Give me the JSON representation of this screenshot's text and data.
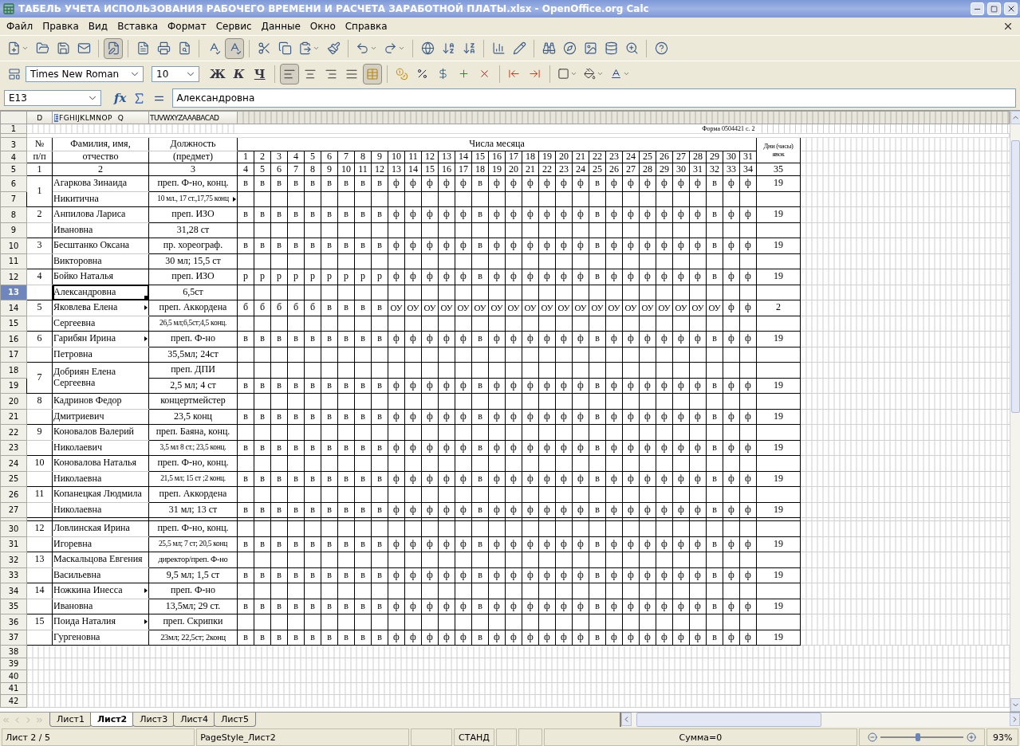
{
  "window": {
    "title": "ТАБЕЛЬ УЧЕТА ИСПОЛЬЗОВАНИЯ РАБОЧЕГО ВРЕМЕНИ И РАСЧЕТА ЗАРАБОТНОЙ ПЛАТЫ.xlsx - OpenOffice.org Calc"
  },
  "menu": [
    "Файл",
    "Правка",
    "Вид",
    "Вставка",
    "Формат",
    "Сервис",
    "Данные",
    "Окно",
    "Справка"
  ],
  "standard_toolbar": {
    "edit_mode": true,
    "auto_spellcheck": true
  },
  "formatting_toolbar": {
    "font_name": "Times New Roman",
    "font_size": "10",
    "style_buttons": [
      "Ж",
      "К",
      "Ч"
    ],
    "alignment": [
      {
        "selected": true
      },
      {
        "selected": false
      },
      {
        "selected": false
      },
      {
        "selected": false
      }
    ],
    "merge_on": true
  },
  "formula_bar": {
    "cell": "E13",
    "function_wizard": "fx",
    "content": "Александровна"
  },
  "column_headers": {
    "number": [
      {
        "label": "D",
        "selected": false
      }
    ],
    "name": [
      {
        "label": "E",
        "selected": true
      },
      {
        "label": "F",
        "selected": false
      },
      {
        "label": "G",
        "selected": false
      },
      {
        "label": "H",
        "selected": false
      },
      {
        "label": "I",
        "selected": false
      },
      {
        "label": "J",
        "selected": false
      },
      {
        "label": "K",
        "selected": false
      },
      {
        "label": "L",
        "selected": false
      },
      {
        "label": "M",
        "selected": false
      },
      {
        "label": "N",
        "selected": false
      },
      {
        "label": "O",
        "selected": false
      },
      {
        "label": "P",
        "selected": false
      },
      {
        "label": "Q",
        "selected": false
      }
    ],
    "position": [
      {
        "label": "T",
        "selected": false
      },
      {
        "label": "U",
        "selected": false
      },
      {
        "label": "V",
        "selected": false
      },
      {
        "label": "W",
        "selected": false
      },
      {
        "label": "X",
        "selected": false
      },
      {
        "label": "Y",
        "selected": false
      },
      {
        "label": "Z",
        "selected": false
      },
      {
        "label": "AA",
        "selected": false
      },
      {
        "label": "AB",
        "selected": false
      },
      {
        "label": "AC",
        "selected": false
      },
      {
        "label": "AD",
        "selected": false
      }
    ]
  },
  "form_header": {
    "row_numbers": [
      "1",
      "3",
      "4",
      "5"
    ],
    "form_code": "Форма 0504421 с. 2",
    "number_heading": [
      "№",
      "п/п"
    ],
    "name_heading": [
      "Фамилия, имя,",
      "отчество"
    ],
    "position_heading": [
      "Должность",
      "(предмет)"
    ],
    "days_heading": "Числа месяца",
    "total_heading": "Дни (часы) явок",
    "days": [
      "1",
      "2",
      "3",
      "4",
      "5",
      "6",
      "7",
      "8",
      "9",
      "10",
      "11",
      "12",
      "13",
      "14",
      "15",
      "16",
      "17",
      "18",
      "19",
      "20",
      "21",
      "22",
      "23",
      "24",
      "25",
      "26",
      "27",
      "28",
      "29",
      "30",
      "31"
    ],
    "column_numbers": [
      "1",
      "2",
      "3",
      "4",
      "5",
      "6",
      "7",
      "8",
      "9",
      "10",
      "11",
      "12",
      "13",
      "14",
      "15",
      "16",
      "17",
      "18",
      "19",
      "20",
      "21",
      "22",
      "23",
      "24",
      "25",
      "26",
      "27",
      "28",
      "29",
      "30",
      "31",
      "32",
      "33",
      "34",
      "35"
    ]
  },
  "people": [
    {
      "kind": "person",
      "number": "1",
      "merged": true,
      "rows": [
        {
          "row": "6",
          "selected": false,
          "name": "Агаркова Зинаида",
          "position": "преп. Ф-но, конц.",
          "marks": [
            "в",
            "в",
            "в",
            "в",
            "в",
            "в",
            "в",
            "в",
            "в",
            "ф",
            "ф",
            "ф",
            "ф",
            "ф",
            "в",
            "ф",
            "ф",
            "ф",
            "ф",
            "ф",
            "ф",
            "в",
            "ф",
            "ф",
            "ф",
            "ф",
            "ф",
            "ф",
            "в",
            "ф",
            "ф"
          ],
          "total": "19"
        },
        {
          "row": "7",
          "selected": false,
          "name": "Никитична",
          "position": "10 мл., 17 ст.,17,75 конц",
          "position_overflow": true
        }
      ]
    },
    {
      "kind": "person",
      "number": "2",
      "merged": false,
      "rows": [
        {
          "row": "8",
          "selected": false,
          "name": "Анпилова Лариса",
          "position": "преп. ИЗО",
          "marks": [
            "в",
            "в",
            "в",
            "в",
            "в",
            "в",
            "в",
            "в",
            "в",
            "ф",
            "ф",
            "ф",
            "ф",
            "ф",
            "в",
            "ф",
            "ф",
            "ф",
            "ф",
            "ф",
            "ф",
            "в",
            "ф",
            "ф",
            "ф",
            "ф",
            "ф",
            "ф",
            "в",
            "ф",
            "ф"
          ],
          "total": "19"
        },
        {
          "row": "9",
          "selected": false,
          "name": "Ивановна",
          "position": "31,28 ст"
        }
      ]
    },
    {
      "kind": "person",
      "number": "3",
      "merged": false,
      "rows": [
        {
          "row": "10",
          "selected": false,
          "name": "Бесштанко Оксана",
          "position": "пр. хореограф.",
          "marks": [
            "в",
            "в",
            "в",
            "в",
            "в",
            "в",
            "в",
            "в",
            "в",
            "ф",
            "ф",
            "ф",
            "ф",
            "ф",
            "в",
            "ф",
            "ф",
            "ф",
            "ф",
            "ф",
            "ф",
            "в",
            "ф",
            "ф",
            "ф",
            "ф",
            "ф",
            "ф",
            "в",
            "ф",
            "ф"
          ],
          "total": "19"
        },
        {
          "row": "11",
          "selected": false,
          "name": "Викторовна",
          "position": "30 мл; 15,5 ст"
        }
      ]
    },
    {
      "kind": "person",
      "number": "4",
      "merged": false,
      "rows": [
        {
          "row": "12",
          "selected": false,
          "name": "Бойко Наталья",
          "position": "преп. ИЗО",
          "marks": [
            "р",
            "р",
            "р",
            "р",
            "р",
            "р",
            "р",
            "р",
            "р",
            "ф",
            "ф",
            "ф",
            "ф",
            "ф",
            "в",
            "ф",
            "ф",
            "ф",
            "ф",
            "ф",
            "ф",
            "в",
            "ф",
            "ф",
            "ф",
            "ф",
            "ф",
            "ф",
            "в",
            "ф",
            "ф"
          ],
          "total": "19"
        },
        {
          "row": "13",
          "selected": true,
          "name": "Александровна",
          "position": "6,5ст"
        }
      ]
    },
    {
      "kind": "person",
      "number": "5",
      "merged": false,
      "rows": [
        {
          "row": "14",
          "selected": false,
          "name": "Яковлева  Елена",
          "name_overflow": true,
          "position": "преп. Аккордена",
          "marks": [
            "б",
            "б",
            "б",
            "б",
            "б",
            "в",
            "в",
            "в",
            "в",
            "ОУ",
            "ОУ",
            "ОУ",
            "ОУ",
            "ОУ",
            "ОУ",
            "ОУ",
            "ОУ",
            "ОУ",
            "ОУ",
            "ОУ",
            "ОУ",
            "ОУ",
            "ОУ",
            "ОУ",
            "ОУ",
            "ОУ",
            "ОУ",
            "ОУ",
            "ОУ",
            "ф",
            "ф"
          ],
          "total": "2"
        },
        {
          "row": "15",
          "selected": false,
          "name": "Сергеевна",
          "position": "26,5 мл;6,5ст;4,5 конц."
        }
      ]
    },
    {
      "kind": "person",
      "number": "6",
      "merged": false,
      "rows": [
        {
          "row": "16",
          "selected": false,
          "name": "Гарибян Ирина",
          "name_overflow": true,
          "position": "преп. Ф-но",
          "marks": [
            "в",
            "в",
            "в",
            "в",
            "в",
            "в",
            "в",
            "в",
            "в",
            "ф",
            "ф",
            "ф",
            "ф",
            "ф",
            "в",
            "ф",
            "ф",
            "ф",
            "ф",
            "ф",
            "ф",
            "в",
            "ф",
            "ф",
            "ф",
            "ф",
            "ф",
            "ф",
            "в",
            "ф",
            "ф"
          ],
          "total": "19"
        },
        {
          "row": "17",
          "selected": false,
          "name": "Петровна",
          "position": "35,5мл;  24ст"
        }
      ]
    },
    {
      "kind": "person",
      "number": "7",
      "merged": true,
      "name": "Добриян Елена Сергеевна",
      "rows": [
        {
          "row": "18",
          "selected": false,
          "position": "преп. ДПИ"
        },
        {
          "row": "19",
          "selected": false,
          "position": "2,5 мл; 4 ст",
          "marks": [
            "в",
            "в",
            "в",
            "в",
            "в",
            "в",
            "в",
            "в",
            "в",
            "ф",
            "ф",
            "ф",
            "ф",
            "ф",
            "в",
            "ф",
            "ф",
            "ф",
            "ф",
            "ф",
            "ф",
            "в",
            "ф",
            "ф",
            "ф",
            "ф",
            "ф",
            "ф",
            "в",
            "ф",
            "ф"
          ],
          "total": "19"
        }
      ]
    },
    {
      "kind": "person",
      "number": "8",
      "merged": false,
      "rows": [
        {
          "row": "20",
          "selected": false,
          "name": "Кадринов Федор",
          "position": "концертмейстер"
        },
        {
          "row": "21",
          "selected": false,
          "name": "Дмитриевич",
          "position": "23,5 конц",
          "marks": [
            "в",
            "в",
            "в",
            "в",
            "в",
            "в",
            "в",
            "в",
            "в",
            "ф",
            "ф",
            "ф",
            "ф",
            "ф",
            "в",
            "ф",
            "ф",
            "ф",
            "ф",
            "ф",
            "ф",
            "в",
            "ф",
            "ф",
            "ф",
            "ф",
            "ф",
            "ф",
            "в",
            "ф",
            "ф"
          ],
          "total": "19"
        }
      ]
    },
    {
      "kind": "person",
      "number": "9",
      "merged": false,
      "rows": [
        {
          "row": "22",
          "selected": false,
          "name": "Коновалов Валерий",
          "position": "преп. Баяна, конц."
        },
        {
          "row": "23",
          "selected": false,
          "name": "Николаевич",
          "position": "3,5 мл 8 ст.; 23,5 конц.",
          "marks": [
            "в",
            "в",
            "в",
            "в",
            "в",
            "в",
            "в",
            "в",
            "в",
            "ф",
            "ф",
            "ф",
            "ф",
            "ф",
            "в",
            "ф",
            "ф",
            "ф",
            "ф",
            "ф",
            "ф",
            "в",
            "ф",
            "ф",
            "ф",
            "ф",
            "ф",
            "ф",
            "в",
            "ф",
            "ф"
          ],
          "total": "19"
        }
      ]
    },
    {
      "kind": "person",
      "number": "10",
      "merged": false,
      "rows": [
        {
          "row": "24",
          "selected": false,
          "name": "Коновалова Наталья",
          "position": "преп. Ф-но, конц."
        },
        {
          "row": "25",
          "selected": false,
          "name": "Николаевна",
          "position": "21,5 мл; 15 ст ;2 конц.",
          "marks": [
            "в",
            "в",
            "в",
            "в",
            "в",
            "в",
            "в",
            "в",
            "в",
            "ф",
            "ф",
            "ф",
            "ф",
            "ф",
            "в",
            "ф",
            "ф",
            "ф",
            "ф",
            "ф",
            "ф",
            "в",
            "ф",
            "ф",
            "ф",
            "ф",
            "ф",
            "ф",
            "в",
            "ф",
            "ф"
          ],
          "total": "19"
        }
      ]
    },
    {
      "kind": "person",
      "number": "11",
      "merged": false,
      "rows": [
        {
          "row": "26",
          "selected": false,
          "name": "Копанецкая Людмила",
          "position": "преп. Аккордена"
        },
        {
          "row": "27",
          "selected": false,
          "name": "Николаевна",
          "position": "31 мл; 13 ст",
          "marks": [
            "в",
            "в",
            "в",
            "в",
            "в",
            "в",
            "в",
            "в",
            "в",
            "ф",
            "ф",
            "ф",
            "ф",
            "ф",
            "в",
            "ф",
            "ф",
            "ф",
            "ф",
            "ф",
            "ф",
            "в",
            "ф",
            "ф",
            "ф",
            "ф",
            "ф",
            "ф",
            "в",
            "ф",
            "ф"
          ],
          "total": "19"
        }
      ]
    },
    {
      "kind": "thin"
    },
    {
      "kind": "person",
      "number": "12",
      "merged": false,
      "rows": [
        {
          "row": "30",
          "selected": false,
          "name": "Ловлинская Ирина",
          "position": "преп. Ф-но, конц."
        },
        {
          "row": "31",
          "selected": false,
          "name": "Игоревна",
          "position": "25,5 мл; 7 ст; 20,5 конц",
          "marks": [
            "в",
            "в",
            "в",
            "в",
            "в",
            "в",
            "в",
            "в",
            "в",
            "ф",
            "ф",
            "ф",
            "ф",
            "ф",
            "в",
            "ф",
            "ф",
            "ф",
            "ф",
            "ф",
            "ф",
            "в",
            "ф",
            "ф",
            "ф",
            "ф",
            "ф",
            "ф",
            "в",
            "ф",
            "ф"
          ],
          "total": "19"
        }
      ]
    },
    {
      "kind": "person",
      "number": "13",
      "merged": false,
      "rows": [
        {
          "row": "32",
          "selected": false,
          "name": "Маскальцова Евгения",
          "position": "директор/преп. Ф-но"
        },
        {
          "row": "33",
          "selected": false,
          "name": "Васильевна",
          "position": "9,5 мл;  1,5 ст",
          "marks": [
            "в",
            "в",
            "в",
            "в",
            "в",
            "в",
            "в",
            "в",
            "в",
            "ф",
            "ф",
            "ф",
            "ф",
            "ф",
            "в",
            "ф",
            "ф",
            "ф",
            "ф",
            "ф",
            "ф",
            "в",
            "ф",
            "ф",
            "ф",
            "ф",
            "ф",
            "ф",
            "в",
            "ф",
            "ф"
          ],
          "total": "19"
        }
      ]
    },
    {
      "kind": "person",
      "number": "14",
      "merged": false,
      "rows": [
        {
          "row": "34",
          "selected": false,
          "name": "Ножкина Инесса",
          "name_overflow": true,
          "position": "преп. Ф-но"
        },
        {
          "row": "35",
          "selected": false,
          "name": "Ивановна",
          "position": "13,5мл; 29 ст.",
          "marks": [
            "в",
            "в",
            "в",
            "в",
            "в",
            "в",
            "в",
            "в",
            "в",
            "ф",
            "ф",
            "ф",
            "ф",
            "ф",
            "в",
            "ф",
            "ф",
            "ф",
            "ф",
            "ф",
            "ф",
            "в",
            "ф",
            "ф",
            "ф",
            "ф",
            "ф",
            "ф",
            "в",
            "ф",
            "ф"
          ],
          "total": "19"
        }
      ]
    },
    {
      "kind": "person",
      "number": "15",
      "merged": false,
      "rows": [
        {
          "row": "36",
          "selected": false,
          "name": "Поида Наталия",
          "name_overflow": true,
          "position": "преп. Скрипки"
        },
        {
          "row": "37",
          "selected": false,
          "name": "Гургеновна",
          "position": "23мл; 22,5ст; 2конц",
          "marks": [
            "в",
            "в",
            "в",
            "в",
            "в",
            "в",
            "в",
            "в",
            "в",
            "ф",
            "ф",
            "ф",
            "ф",
            "ф",
            "в",
            "ф",
            "ф",
            "ф",
            "ф",
            "ф",
            "ф",
            "в",
            "ф",
            "ф",
            "ф",
            "ф",
            "ф",
            "ф",
            "в",
            "ф",
            "ф"
          ],
          "total": "19"
        }
      ]
    }
  ],
  "empty_rows": [
    "38",
    "39",
    "40",
    "41",
    "42"
  ],
  "sheet_tabs": [
    {
      "label": "Лист1",
      "selected": false
    },
    {
      "label": "Лист2",
      "selected": true
    },
    {
      "label": "Лист3",
      "selected": false
    },
    {
      "label": "Лист4",
      "selected": false
    },
    {
      "label": "Лист5",
      "selected": false
    }
  ],
  "status_bar": {
    "sheet": "Лист 2 / 5",
    "page_style": "PageStyle_Лист2",
    "mode": "СТАНД",
    "sum": "Сумма=0",
    "zoom": {
      "level": 0.45,
      "reading": "93%"
    }
  }
}
